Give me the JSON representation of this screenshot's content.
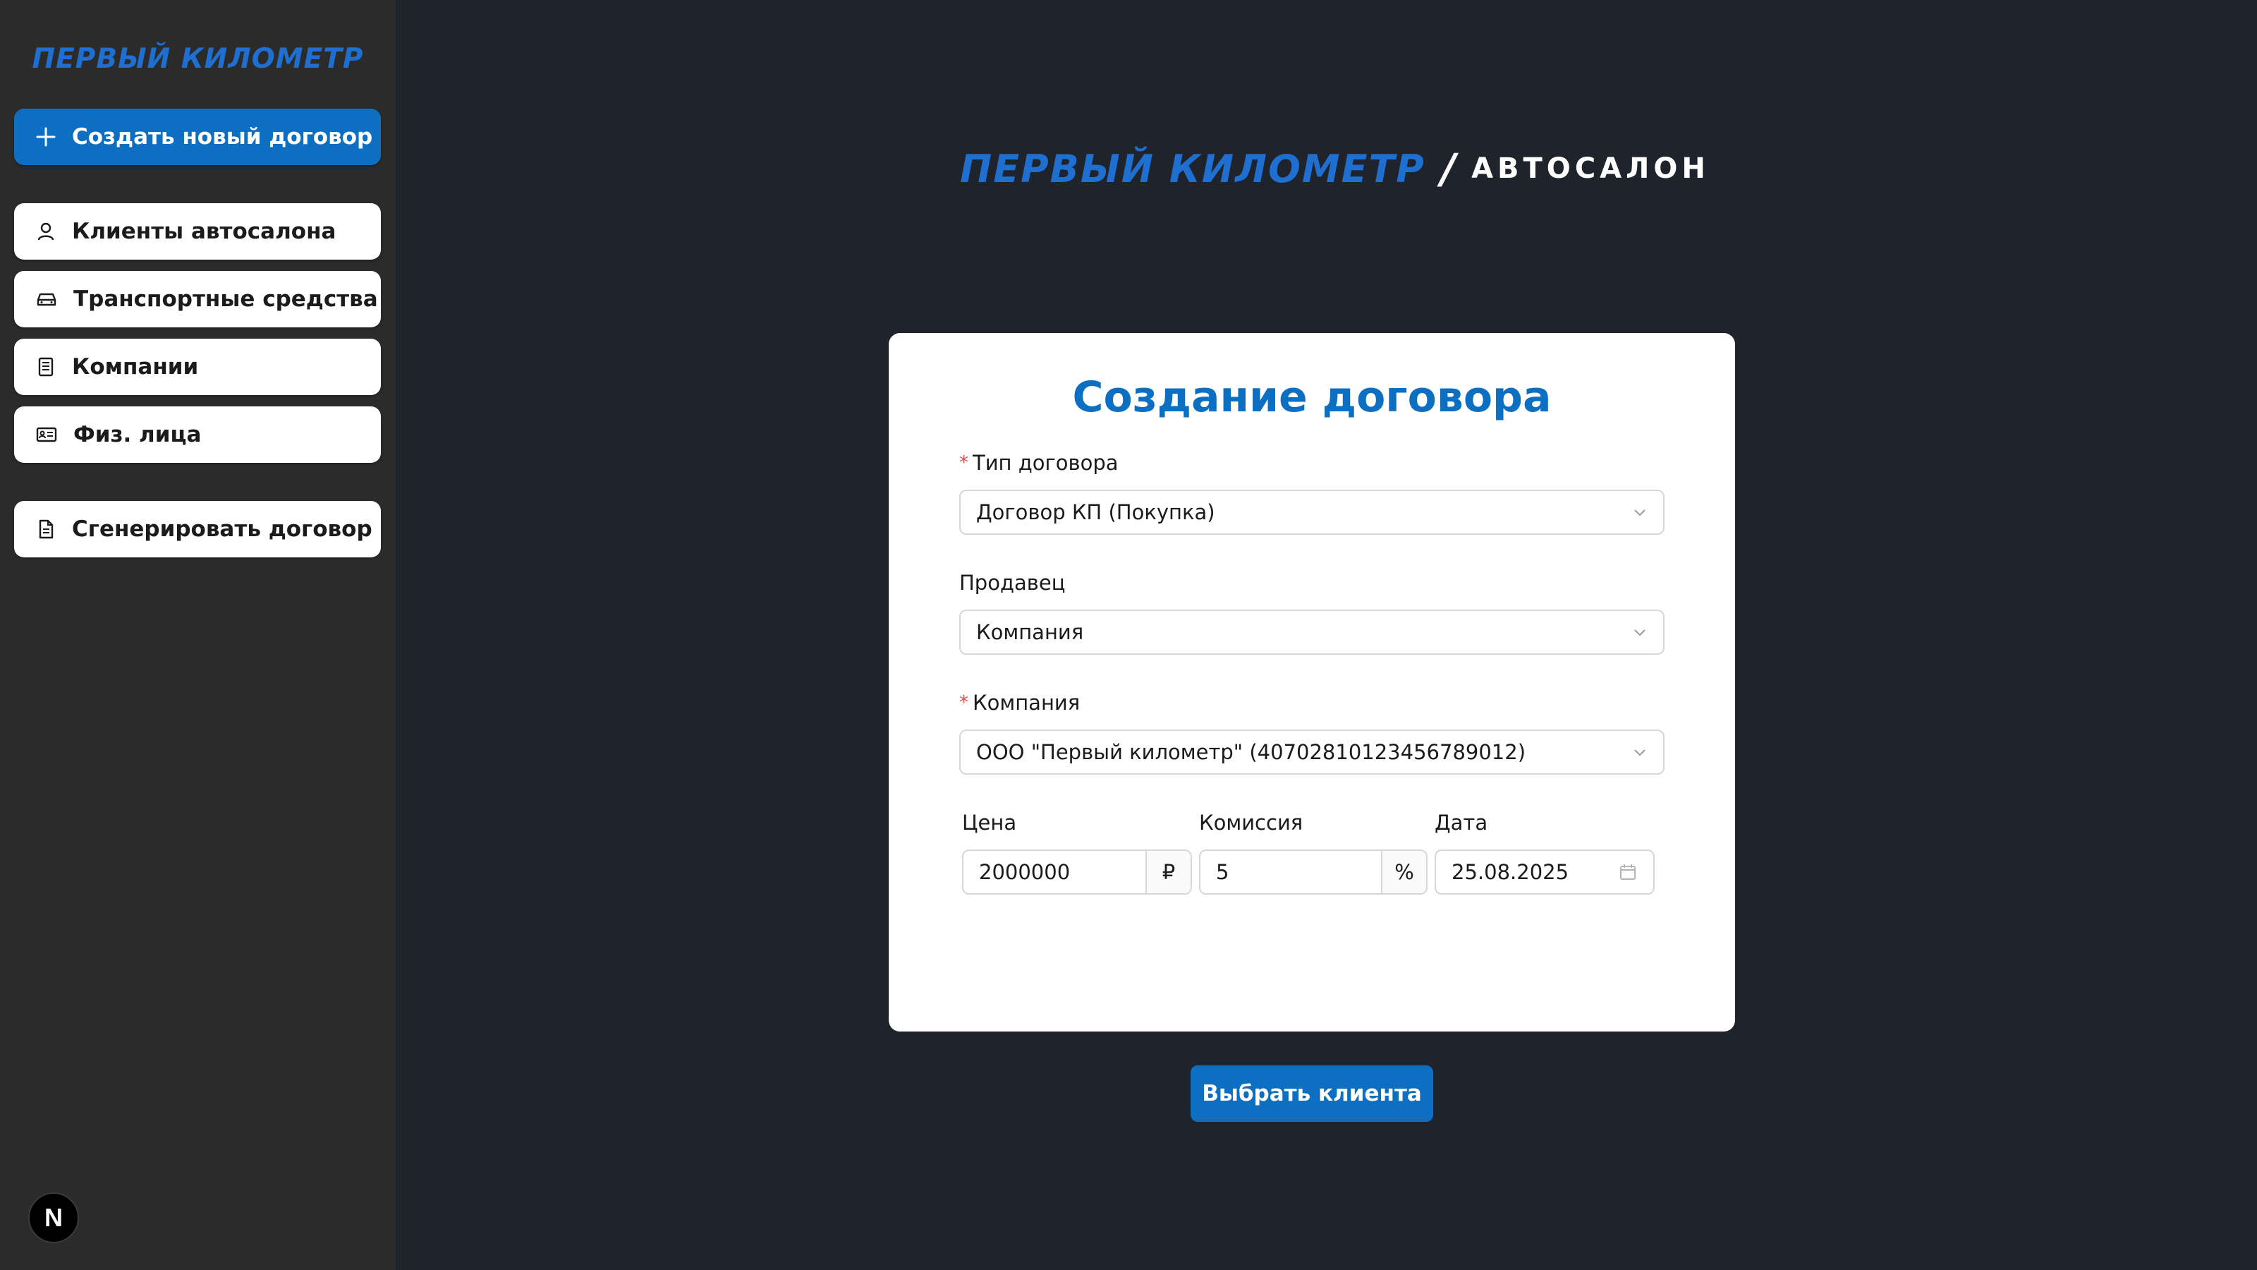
{
  "sidebar": {
    "logo": "ПЕРВЫЙ КИЛОМЕТР",
    "create_button": "Создать новый договор",
    "items": [
      {
        "label": "Клиенты автосалона"
      },
      {
        "label": "Транспортные средства"
      },
      {
        "label": "Компании"
      },
      {
        "label": "Физ. лица"
      }
    ],
    "generate_button": "Сгенерировать договор"
  },
  "brand": {
    "main": "ПЕРВЫЙ КИЛОМЕТР",
    "slash": "/",
    "sub": "АВТОСАЛОН"
  },
  "form": {
    "title": "Создание договора",
    "contract_type": {
      "label": "Тип договора",
      "required": true,
      "value": "Договор КП (Покупка)"
    },
    "seller": {
      "label": "Продавец",
      "required": false,
      "value": "Компания"
    },
    "company": {
      "label": "Компания",
      "required": true,
      "value": "ООО \"Первый километр\" (40702810123456789012)"
    },
    "price": {
      "label": "Цена",
      "value": "2000000",
      "addon": "₽"
    },
    "commission": {
      "label": "Комиссия",
      "value": "5",
      "addon": "%"
    },
    "date": {
      "label": "Дата",
      "value": "25.08.2025"
    }
  },
  "action_button": "Выбрать клиента",
  "badge": "N",
  "colors": {
    "accent": "#0d6fc1",
    "sidebar_bg": "#2b2b2b",
    "main_bg": "#1f232c",
    "required": "#e24c4c"
  }
}
